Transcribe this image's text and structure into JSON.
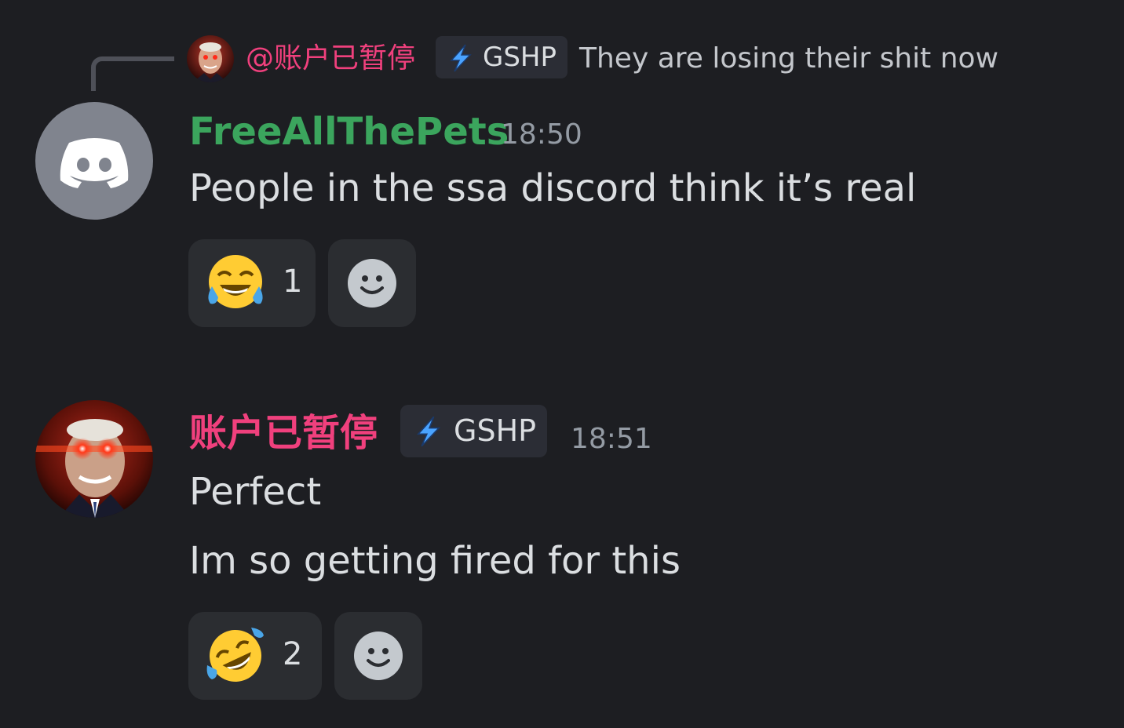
{
  "reply": {
    "username": "@账户已暂停",
    "tag": "GSHP",
    "text": "They are losing their shit now"
  },
  "messages": [
    {
      "username": "FreeAllThePets",
      "name_color": "#3ba55d",
      "timestamp": "18:50",
      "lines": [
        "People in the ssa discord think it’s real"
      ],
      "reactions": [
        {
          "emoji": "face-with-tears-of-joy",
          "count": "1"
        }
      ]
    },
    {
      "username": "账户已暂停",
      "name_color": "#f0407d",
      "tag": "GSHP",
      "timestamp": "18:51",
      "lines": [
        "Perfect",
        "Im so getting fired for this"
      ],
      "reactions": [
        {
          "emoji": "rolling-on-the-floor-laughing",
          "count": "2"
        }
      ]
    }
  ],
  "colors": {
    "background": "#1d1e22",
    "reaction_bg": "#2b2d31",
    "tag_bolt": "#4aa3ff"
  }
}
